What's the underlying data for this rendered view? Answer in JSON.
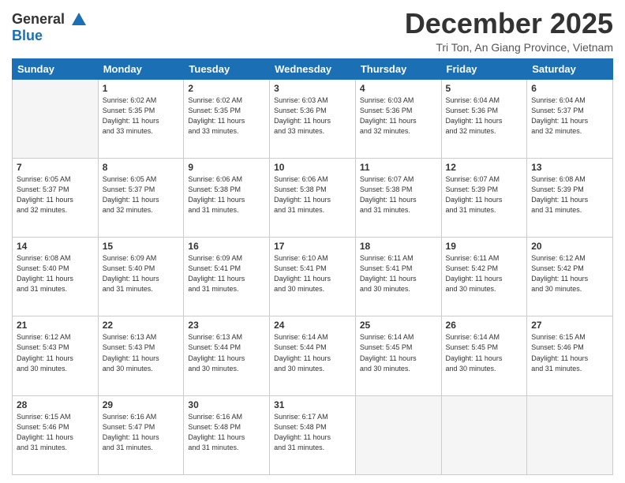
{
  "header": {
    "logo_line1": "General",
    "logo_line2": "Blue",
    "month": "December 2025",
    "location": "Tri Ton, An Giang Province, Vietnam"
  },
  "weekdays": [
    "Sunday",
    "Monday",
    "Tuesday",
    "Wednesday",
    "Thursday",
    "Friday",
    "Saturday"
  ],
  "weeks": [
    [
      {
        "day": "",
        "info": ""
      },
      {
        "day": "1",
        "info": "Sunrise: 6:02 AM\nSunset: 5:35 PM\nDaylight: 11 hours\nand 33 minutes."
      },
      {
        "day": "2",
        "info": "Sunrise: 6:02 AM\nSunset: 5:35 PM\nDaylight: 11 hours\nand 33 minutes."
      },
      {
        "day": "3",
        "info": "Sunrise: 6:03 AM\nSunset: 5:36 PM\nDaylight: 11 hours\nand 33 minutes."
      },
      {
        "day": "4",
        "info": "Sunrise: 6:03 AM\nSunset: 5:36 PM\nDaylight: 11 hours\nand 32 minutes."
      },
      {
        "day": "5",
        "info": "Sunrise: 6:04 AM\nSunset: 5:36 PM\nDaylight: 11 hours\nand 32 minutes."
      },
      {
        "day": "6",
        "info": "Sunrise: 6:04 AM\nSunset: 5:37 PM\nDaylight: 11 hours\nand 32 minutes."
      }
    ],
    [
      {
        "day": "7",
        "info": "Sunrise: 6:05 AM\nSunset: 5:37 PM\nDaylight: 11 hours\nand 32 minutes."
      },
      {
        "day": "8",
        "info": "Sunrise: 6:05 AM\nSunset: 5:37 PM\nDaylight: 11 hours\nand 32 minutes."
      },
      {
        "day": "9",
        "info": "Sunrise: 6:06 AM\nSunset: 5:38 PM\nDaylight: 11 hours\nand 31 minutes."
      },
      {
        "day": "10",
        "info": "Sunrise: 6:06 AM\nSunset: 5:38 PM\nDaylight: 11 hours\nand 31 minutes."
      },
      {
        "day": "11",
        "info": "Sunrise: 6:07 AM\nSunset: 5:38 PM\nDaylight: 11 hours\nand 31 minutes."
      },
      {
        "day": "12",
        "info": "Sunrise: 6:07 AM\nSunset: 5:39 PM\nDaylight: 11 hours\nand 31 minutes."
      },
      {
        "day": "13",
        "info": "Sunrise: 6:08 AM\nSunset: 5:39 PM\nDaylight: 11 hours\nand 31 minutes."
      }
    ],
    [
      {
        "day": "14",
        "info": "Sunrise: 6:08 AM\nSunset: 5:40 PM\nDaylight: 11 hours\nand 31 minutes."
      },
      {
        "day": "15",
        "info": "Sunrise: 6:09 AM\nSunset: 5:40 PM\nDaylight: 11 hours\nand 31 minutes."
      },
      {
        "day": "16",
        "info": "Sunrise: 6:09 AM\nSunset: 5:41 PM\nDaylight: 11 hours\nand 31 minutes."
      },
      {
        "day": "17",
        "info": "Sunrise: 6:10 AM\nSunset: 5:41 PM\nDaylight: 11 hours\nand 30 minutes."
      },
      {
        "day": "18",
        "info": "Sunrise: 6:11 AM\nSunset: 5:41 PM\nDaylight: 11 hours\nand 30 minutes."
      },
      {
        "day": "19",
        "info": "Sunrise: 6:11 AM\nSunset: 5:42 PM\nDaylight: 11 hours\nand 30 minutes."
      },
      {
        "day": "20",
        "info": "Sunrise: 6:12 AM\nSunset: 5:42 PM\nDaylight: 11 hours\nand 30 minutes."
      }
    ],
    [
      {
        "day": "21",
        "info": "Sunrise: 6:12 AM\nSunset: 5:43 PM\nDaylight: 11 hours\nand 30 minutes."
      },
      {
        "day": "22",
        "info": "Sunrise: 6:13 AM\nSunset: 5:43 PM\nDaylight: 11 hours\nand 30 minutes."
      },
      {
        "day": "23",
        "info": "Sunrise: 6:13 AM\nSunset: 5:44 PM\nDaylight: 11 hours\nand 30 minutes."
      },
      {
        "day": "24",
        "info": "Sunrise: 6:14 AM\nSunset: 5:44 PM\nDaylight: 11 hours\nand 30 minutes."
      },
      {
        "day": "25",
        "info": "Sunrise: 6:14 AM\nSunset: 5:45 PM\nDaylight: 11 hours\nand 30 minutes."
      },
      {
        "day": "26",
        "info": "Sunrise: 6:14 AM\nSunset: 5:45 PM\nDaylight: 11 hours\nand 30 minutes."
      },
      {
        "day": "27",
        "info": "Sunrise: 6:15 AM\nSunset: 5:46 PM\nDaylight: 11 hours\nand 31 minutes."
      }
    ],
    [
      {
        "day": "28",
        "info": "Sunrise: 6:15 AM\nSunset: 5:46 PM\nDaylight: 11 hours\nand 31 minutes."
      },
      {
        "day": "29",
        "info": "Sunrise: 6:16 AM\nSunset: 5:47 PM\nDaylight: 11 hours\nand 31 minutes."
      },
      {
        "day": "30",
        "info": "Sunrise: 6:16 AM\nSunset: 5:48 PM\nDaylight: 11 hours\nand 31 minutes."
      },
      {
        "day": "31",
        "info": "Sunrise: 6:17 AM\nSunset: 5:48 PM\nDaylight: 11 hours\nand 31 minutes."
      },
      {
        "day": "",
        "info": ""
      },
      {
        "day": "",
        "info": ""
      },
      {
        "day": "",
        "info": ""
      }
    ]
  ]
}
